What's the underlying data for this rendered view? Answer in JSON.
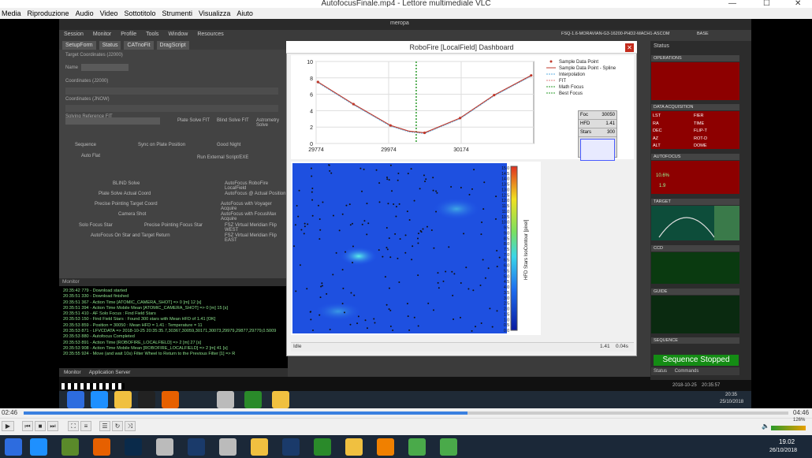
{
  "vlc": {
    "title": "AutofocusFinale.mp4 - Lettore multimediale VLC",
    "menu": [
      "Media",
      "Riproduzione",
      "Audio",
      "Video",
      "Sottotitolo",
      "Strumenti",
      "Visualizza",
      "Aiuto"
    ],
    "time_elapsed": "02:46",
    "time_total": "04:46",
    "volume": "126%",
    "progress_fraction": 0.58
  },
  "app": {
    "window_title": "meropa",
    "profile_info": "FSQ-1.6-MORAVIAN-G3-16200-PHD2-MACH1-ASCOM",
    "base_label": "BASE",
    "menu": [
      "Session",
      "Monitor",
      "Profile",
      "Tools",
      "Window",
      "Resources"
    ],
    "tabs": [
      "SetupForm",
      "Status",
      "CATnoFit",
      "DragScript"
    ],
    "form_rows": [
      "Target Coordinates (J2000)",
      "Name",
      "Coordinates (J2000)",
      "Coordinates (JNOW)",
      "Solving Reference FIT"
    ],
    "form_buttons": [
      "Sequence",
      "Sync on Plate Position",
      "Good Night",
      "Auto Flat",
      "Run External Script/EXE",
      "BLIND Solve",
      "AutoFocus RoboFire LocalField",
      "Plate Solve Actual Coord",
      "AutoFocus @ Actual Position",
      "Precise Pointing Target Coord",
      "AutoFocus with Voyager Acquire",
      "Camera Shot",
      "AutoFocus with FocusMax Acquire",
      "Solo Focus Star",
      "Precise Pointing Focus Star",
      "FSZ Virtual Meridian Flip WEST",
      "AutoFocus On Star and Target Return",
      "FSZ Virtual Meridian Flip EAST",
      "Plate Solve FIT",
      "Blind Solve FIT",
      "Astrometry Solve"
    ],
    "monitor_title": "Monitor",
    "monitor_lines": [
      "20:35:42 779 - Download started",
      "20:35:51 330 - Download finished",
      "20:35:51 367 - Action Time [ATOMIC_CAMERA_SHOT] => 0 [m] 12 [s]",
      "20:35:51 394 - Action Time Mobile Mean [ATOMIC_CAMERA_SHOT] => 0 [m] 15 [s]",
      "20:35:51 410 - AF Solo Focus : Find Field Stars",
      "20:35:53 150 - Find Field Stars : Found 300 stars with Mean HFD of 1.41 [OK]",
      "20:35:53 859 - Position = 30050 : Mean HFD = 1.41 : Temperature = 11",
      "20:35:53 871 - LFVCDATA => 2018-10-25 20:35:35.7,30367,30059,30171,30073,29979,29877,29779,0.5009",
      "20:35:53 880 - Autofocus Completed",
      "20:35:53 891 - Action Time [ROBOFIRE_LOCALFIELD] => 2 [m] 27 [s]",
      "20:35:53 908 - Action Time Mobile Mean [ROBOFIRE_LOCALFIELD] => 2 [m] 41 [s]",
      "20:35:55 924 - Move (and wait 10s) Filter Wheel to Return to the Previous Filter [1] => R"
    ],
    "bottom_tabs": [
      "Monitor",
      "Application Server"
    ],
    "clock_date": "2018-10-25",
    "clock_time": "20:35:57",
    "inner_clock": "20:35",
    "inner_date": "25/10/2018"
  },
  "dashboard": {
    "title": "RoboFire [LocalField] Dashboard",
    "legend": [
      "Sample Data Point",
      "Sample Data Point - Spline",
      "Interpolation",
      "FIT",
      "Math Focus",
      "Best Focus"
    ],
    "foc_table": [
      {
        "label": "Foc",
        "value": "30050"
      },
      {
        "label": "HFD",
        "value": "1.41"
      },
      {
        "label": "Stars",
        "value": "300"
      }
    ],
    "status_left": "Idle",
    "status_right_1": "1.41",
    "status_right_2": "0.04s",
    "heat_axis_label": "HFD Stars IsoContour [pixel]",
    "heat_ticks": [
      "15.0",
      "14.5",
      "14.0",
      "13.5",
      "13.0",
      "12.5",
      "12.0",
      "11.5",
      "11.0",
      "10.5",
      "10.0",
      "9.5",
      "9.0",
      "8.5",
      "8.0",
      "7.5",
      "7.0",
      "6.5",
      "6.0",
      "5.5",
      "5.0",
      "4.5",
      "4.0",
      "3.5",
      "3.0",
      "2.5",
      "2.0",
      "1.5",
      "1.0",
      "0.5",
      "0.0"
    ]
  },
  "chart_data": {
    "type": "line",
    "x_ticks": [
      "29774",
      "29974",
      "30174"
    ],
    "y_ticks": [
      "10",
      "8",
      "6",
      "4",
      "2",
      "0"
    ],
    "xlim": [
      29774,
      30374
    ],
    "ylim": [
      0,
      10
    ],
    "series": [
      {
        "name": "Sample Data Point",
        "x": [
          29779,
          29877,
          29979,
          30073,
          30171,
          30265,
          30367
        ],
        "y": [
          7.5,
          4.8,
          2.2,
          1.3,
          3.1,
          5.9,
          8.3
        ]
      },
      {
        "name": "Sample Data Point - Spline",
        "x": [
          29779,
          29877,
          29979,
          30030,
          30073,
          30171,
          30265,
          30367
        ],
        "y": [
          7.5,
          4.8,
          2.2,
          1.5,
          1.3,
          3.1,
          5.9,
          8.3
        ]
      }
    ],
    "best_focus_x": 30050
  },
  "right_panel": {
    "status_title": "Status",
    "sections": [
      "OPERATIONS",
      "DATA ACQUISITION",
      "AUTOFOCUS",
      "TARGET",
      "CCD",
      "GUIDE",
      "SEQUENCE"
    ],
    "acq_labels": [
      "LST",
      "RA",
      "DEC",
      "AZ",
      "ALT",
      "FIER",
      "TIME",
      "FLIP-T",
      "ROT-D",
      "DOME"
    ],
    "af_values": [
      "10.6%",
      "1.9"
    ],
    "sequence_status": "Sequence Stopped",
    "bottom_tabs": [
      "Status",
      "Commands"
    ]
  },
  "os": {
    "time": "19.02",
    "date": "26/10/2018"
  },
  "colors": {
    "accent_red": "#8d0000",
    "sequence_green": "#148c14",
    "heat_low": "#0a2bd9",
    "heat_high": "#e03020"
  }
}
